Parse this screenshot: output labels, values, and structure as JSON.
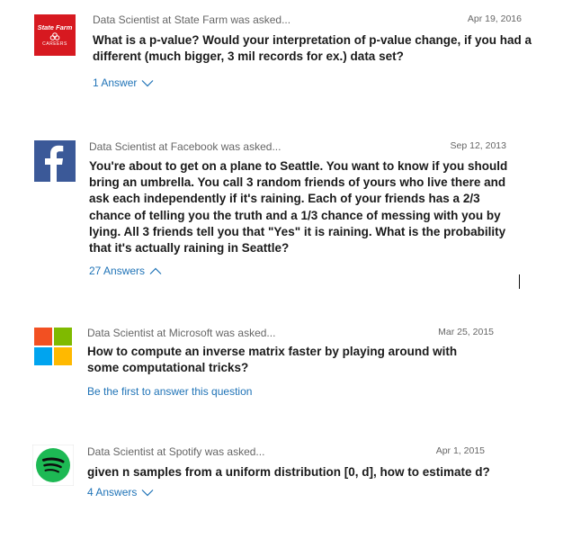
{
  "colors": {
    "link": "#1f73b7",
    "meta": "#666666",
    "text": "#1a1a1a",
    "statefarm_red": "#d71920",
    "facebook_blue": "#3b5998",
    "spotify_green": "#1db954",
    "ms_red": "#f25022",
    "ms_green": "#7fba00",
    "ms_blue": "#00a4ef",
    "ms_yellow": "#ffb900"
  },
  "questions": [
    {
      "company_logo": "state-farm-logo",
      "logo_lines": [
        "State Farm",
        "CAREERS"
      ],
      "meta": "Data Scientist at State Farm was asked...",
      "date": "Apr 19, 2016",
      "text": "What is a p-value? Would your interpretation of p-value change, if you had a different (much bigger, 3 mil records for ex.) data set?",
      "answers_label": "1 Answer",
      "expand_icon": "chevron-down-icon"
    },
    {
      "company_logo": "facebook-logo",
      "meta": "Data Scientist at Facebook was asked...",
      "date": "Sep 12, 2013",
      "text": "You're about to get on a plane to Seattle. You want to know if you should bring an umbrella. You call 3 random friends of yours who live there and ask each independently if it's raining. Each of your friends has a 2/3 chance of telling you the truth and a 1/3 chance of messing with you by lying. All 3 friends tell you that \"Yes\" it is raining. What is the probability that it's actually raining in Seattle?",
      "answers_label": "27 Answers",
      "expand_icon": "chevron-up-icon"
    },
    {
      "company_logo": "microsoft-logo",
      "meta": "Data Scientist at Microsoft was asked...",
      "date": "Mar 25, 2015",
      "text": "How to compute an inverse matrix faster by playing around with some computational tricks?",
      "answers_label": "Be the first to answer this question"
    },
    {
      "company_logo": "spotify-logo",
      "meta": "Data Scientist at Spotify was asked...",
      "date": "Apr 1, 2015",
      "text": "given n samples from a uniform distribution [0, d], how to estimate d?",
      "answers_label": "4 Answers",
      "expand_icon": "chevron-down-icon"
    }
  ]
}
